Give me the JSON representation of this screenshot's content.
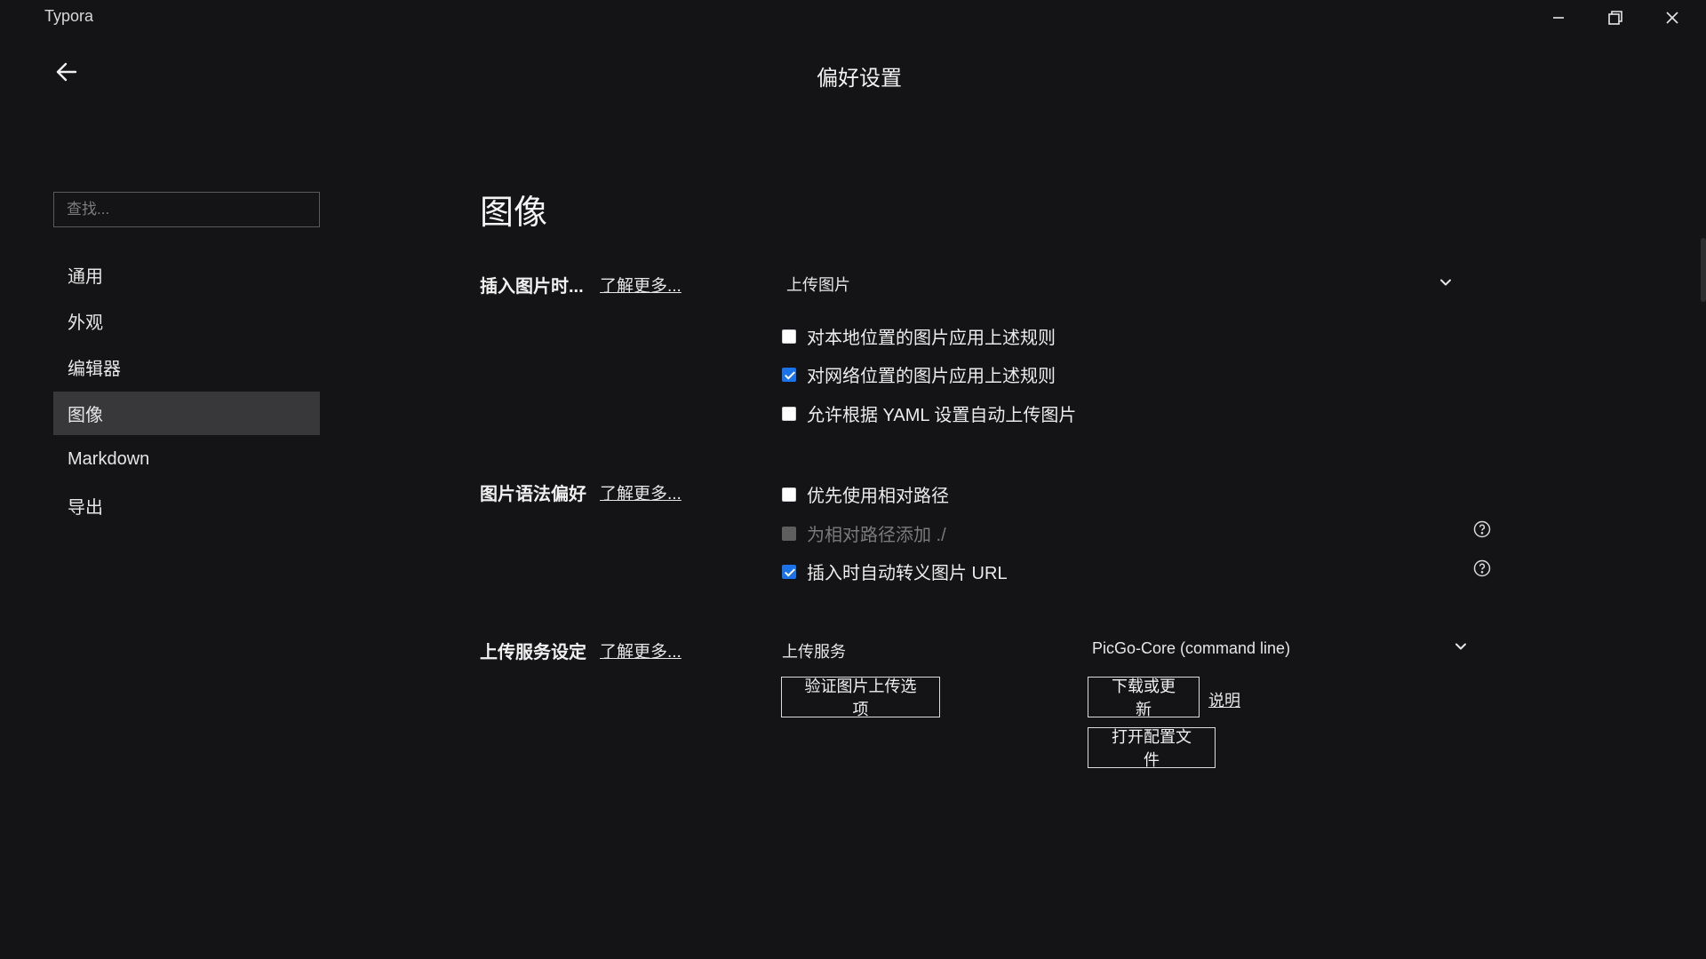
{
  "app": {
    "title": "Typora"
  },
  "header": {
    "title": "偏好设置"
  },
  "sidebar": {
    "search_placeholder": "查找...",
    "items": [
      {
        "label": "通用",
        "active": false
      },
      {
        "label": "外观",
        "active": false
      },
      {
        "label": "编辑器",
        "active": false
      },
      {
        "label": "图像",
        "active": true
      },
      {
        "label": "Markdown",
        "active": false
      },
      {
        "label": "导出",
        "active": false
      }
    ]
  },
  "main": {
    "section_title": "图像",
    "insert_image": {
      "label": "插入图片时...",
      "learn_more": "了解更多...",
      "action_select": "上传图片",
      "options": [
        {
          "label": "对本地位置的图片应用上述规则",
          "checked": false
        },
        {
          "label": "对网络位置的图片应用上述规则",
          "checked": true
        },
        {
          "label": "允许根据 YAML 设置自动上传图片",
          "checked": false
        }
      ]
    },
    "syntax_pref": {
      "label": "图片语法偏好",
      "learn_more": "了解更多...",
      "options": [
        {
          "label": "优先使用相对路径",
          "checked": false,
          "disabled": false
        },
        {
          "label": "为相对路径添加 ./",
          "checked": false,
          "disabled": true
        },
        {
          "label": "插入时自动转义图片 URL",
          "checked": true,
          "disabled": false
        }
      ]
    },
    "upload_service": {
      "label": "上传服务设定",
      "learn_more": "了解更多...",
      "service_label": "上传服务",
      "service_select": "PicGo-Core (command line)",
      "verify_button": "验证图片上传选项",
      "download_button": "下载或更新",
      "explain_link": "说明",
      "open_config_button": "打开配置文件"
    }
  },
  "colors": {
    "accent": "#1a73e8",
    "background": "#141416",
    "active_nav": "#38383a"
  }
}
